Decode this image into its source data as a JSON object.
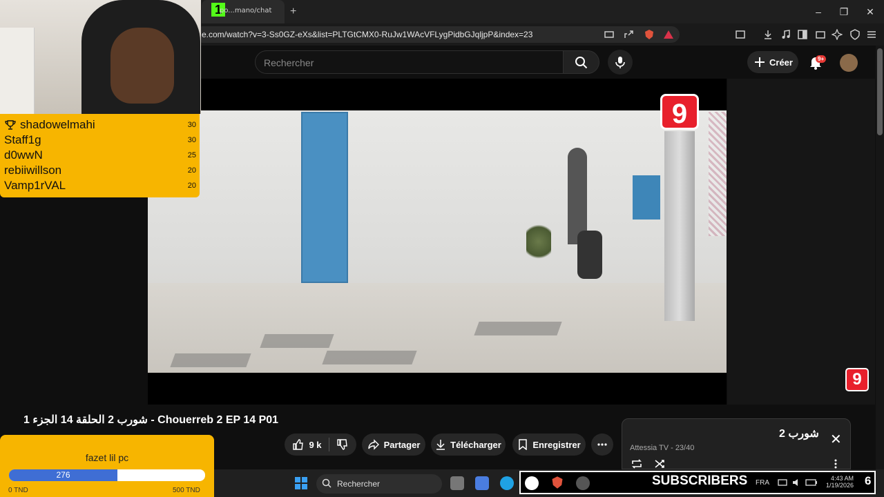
{
  "browser": {
    "tab_text": "po...mano/chat",
    "kick_mark": "1",
    "new_tab": "+",
    "minimize": "–",
    "maximize": "❐",
    "close": "✕",
    "url": "e.com/watch?v=3-Ss0GZ-eXs&list=PLTGtCMX0-RuJw1WAcVFLygPidbGJqljpP&index=23"
  },
  "youtube": {
    "search_placeholder": "Rechercher",
    "create_label": "Créer",
    "notification_badge": "9+"
  },
  "video": {
    "channel_logo": "9",
    "title": "شورب 2 الحلقة 14 الجزء 1 - Chouerreb 2 EP 14 P01",
    "likes": "9 k",
    "share": "Partager",
    "download": "Télécharger",
    "save": "Enregistrer"
  },
  "playlist": {
    "title": "شورب 2",
    "subtitle": "Attessia TV - 23/40",
    "close": "✕"
  },
  "leaderboard": [
    {
      "name": "shadowelmahi",
      "score": "30"
    },
    {
      "name": "Staff1g",
      "score": "30"
    },
    {
      "name": "d0wwN",
      "score": "25"
    },
    {
      "name": "rebiiwillson",
      "score": "20"
    },
    {
      "name": "Vamp1rVAL",
      "score": "20"
    }
  ],
  "goal": {
    "title": "fazet lil pc",
    "current": "276",
    "min_label": "0 TND",
    "max_label": "500 TND",
    "progress_fraction": 0.552
  },
  "taskbar": {
    "search_label": "Rechercher",
    "subscribers_label": "SUBSCRIBERS",
    "subscribers_count": "6",
    "language": "FRA",
    "time": "4:43 AM",
    "date": "1/19/2026"
  },
  "colors": {
    "overlay_yellow": "#f7b500",
    "goal_blue": "#3f6ed4",
    "brand_red": "#e8202c",
    "door_blue": "#4a90c2"
  }
}
